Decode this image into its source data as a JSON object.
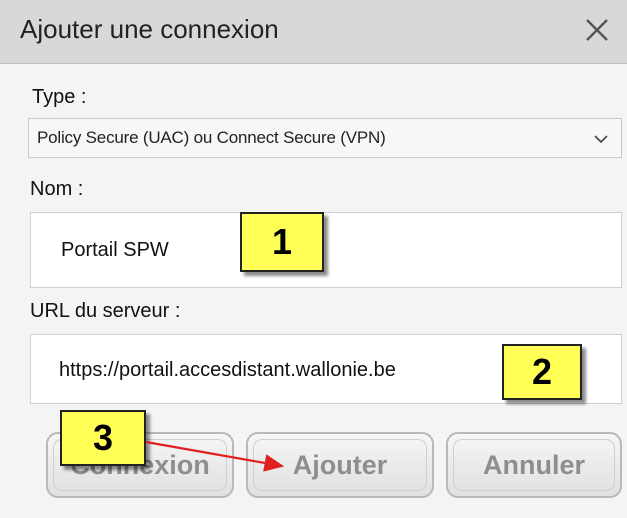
{
  "dialog": {
    "title": "Ajouter une connexion",
    "close_glyph": "✕"
  },
  "type_field": {
    "label": "Type :",
    "selected": "Policy Secure (UAC) ou Connect Secure (VPN)"
  },
  "name_field": {
    "label": "Nom :",
    "value": "Portail SPW"
  },
  "url_field": {
    "label": "URL du serveur :",
    "value": "https://portail.accesdistant.wallonie.be"
  },
  "buttons": {
    "connect": "Connexion",
    "add": "Ajouter",
    "cancel": "Annuler"
  },
  "annotations": {
    "step1": "1",
    "step2": "2",
    "step3": "3",
    "badge_color": "#ffff55",
    "arrow_color": "#e02020"
  }
}
